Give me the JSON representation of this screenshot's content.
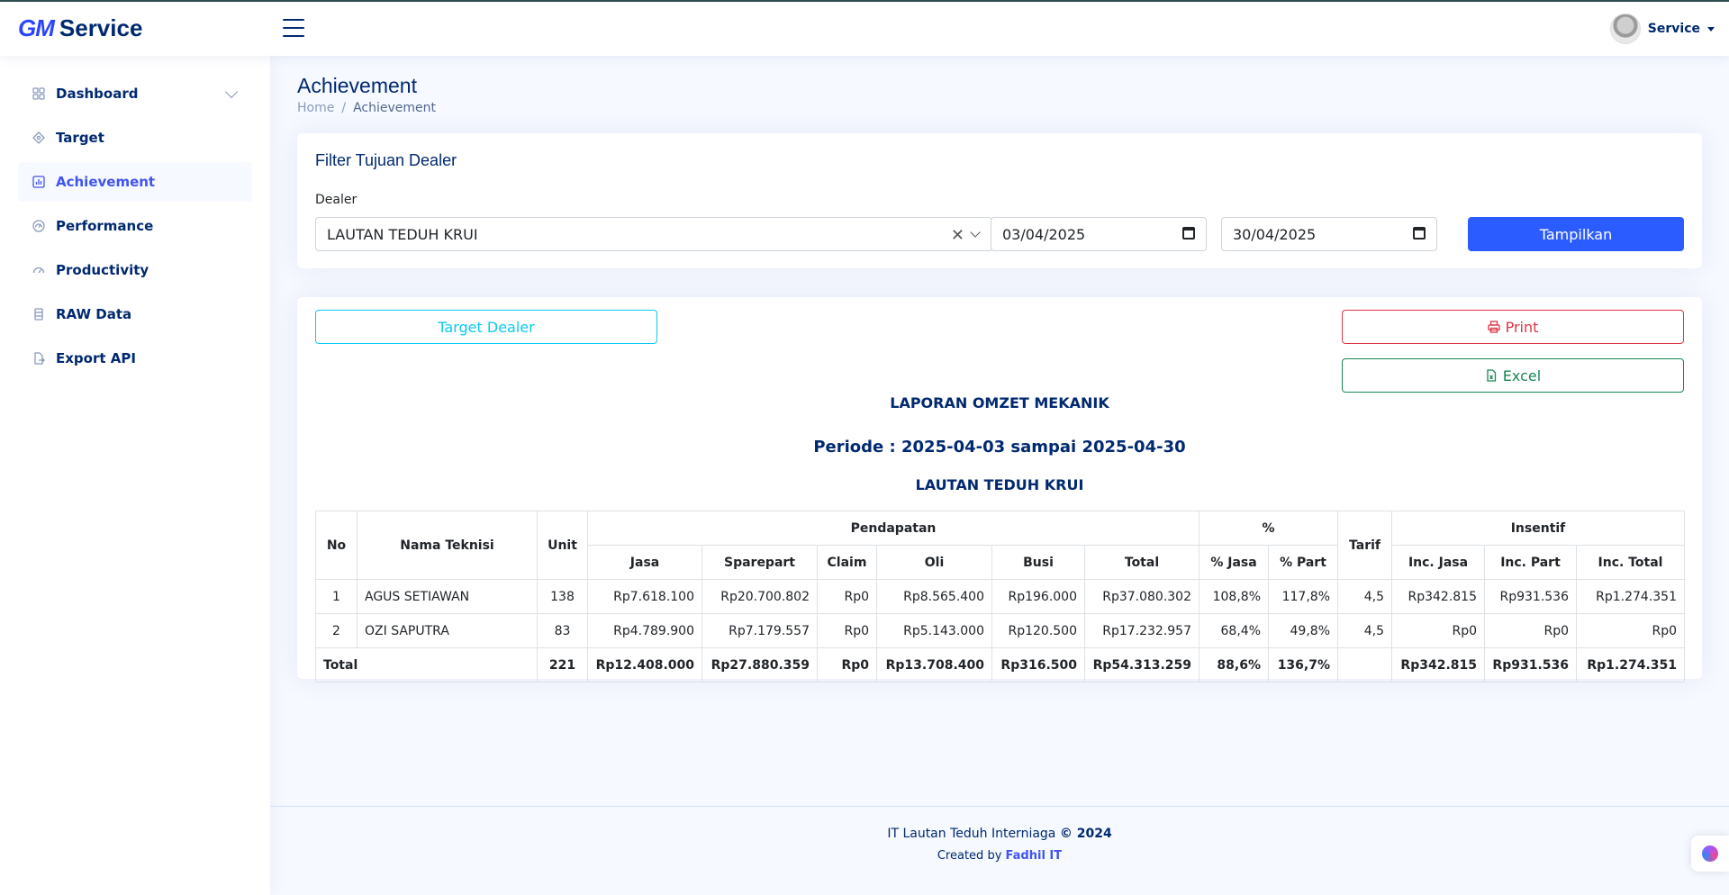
{
  "app": {
    "brand_prefix": "GM",
    "brand_name": "Service",
    "user_name": "Service"
  },
  "sidebar": {
    "items": [
      {
        "label": "Dashboard",
        "icon": "grid-icon",
        "has_chevron": true
      },
      {
        "label": "Target",
        "icon": "target-icon"
      },
      {
        "label": "Achievement",
        "icon": "bar-chart-icon",
        "active": true
      },
      {
        "label": "Performance",
        "icon": "speedometer-icon"
      },
      {
        "label": "Productivity",
        "icon": "gauge-icon"
      },
      {
        "label": "RAW Data",
        "icon": "database-icon"
      },
      {
        "label": "Export API",
        "icon": "file-export-icon"
      }
    ]
  },
  "page": {
    "title": "Achievement",
    "breadcrumb": [
      "Home",
      "/",
      "Achievement"
    ]
  },
  "filter": {
    "title": "Filter Tujuan Dealer",
    "dealer_label": "Dealer",
    "dealer_value": "LAUTAN TEDUH KRUI",
    "clear_symbol": "✕",
    "date_from": "03/04/2025",
    "date_to": "30/04/2025",
    "submit_label": "Tampilkan"
  },
  "report": {
    "target_button": "Target Dealer",
    "print_button": "Print",
    "excel_button": "Excel",
    "heading": "LAPORAN OMZET MEKANIK",
    "period": "Periode : 2025-04-03 sampai 2025-04-30",
    "dealer": "LAUTAN TEDUH KRUI",
    "table": {
      "header_groups": {
        "no": "No",
        "name": "Nama Teknisi",
        "unit": "Unit",
        "pendapatan": "Pendapatan",
        "percent": "%",
        "tarif": "Tarif",
        "insentif": "Insentif"
      },
      "sub_headers": [
        "Jasa",
        "Sparepart",
        "Claim",
        "Oli",
        "Busi",
        "Total",
        "% Jasa",
        "% Part",
        "Inc. Jasa",
        "Inc. Part",
        "Inc. Total"
      ],
      "rows": [
        [
          "1",
          "AGUS SETIAWAN",
          "138",
          "Rp7.618.100",
          "Rp20.700.802",
          "Rp0",
          "Rp8.565.400",
          "Rp196.000",
          "Rp37.080.302",
          "108,8%",
          "117,8%",
          "4,5",
          "Rp342.815",
          "Rp931.536",
          "Rp1.274.351"
        ],
        [
          "2",
          "OZI SAPUTRA",
          "83",
          "Rp4.789.900",
          "Rp7.179.557",
          "Rp0",
          "Rp5.143.000",
          "Rp120.500",
          "Rp17.232.957",
          "68,4%",
          "49,8%",
          "4,5",
          "Rp0",
          "Rp0",
          "Rp0"
        ]
      ],
      "total_row": [
        "Total",
        "221",
        "Rp12.408.000",
        "Rp27.880.359",
        "Rp0",
        "Rp13.708.400",
        "Rp316.500",
        "Rp54.313.259",
        "88,6%",
        "136,7%",
        "",
        "Rp342.815",
        "Rp931.536",
        "Rp1.274.351"
      ]
    }
  },
  "footer": {
    "company": "IT Lautan Teduh Interniaga",
    "copyright": "© 2024",
    "created_by": "Created by",
    "author": "Fadhil IT"
  }
}
